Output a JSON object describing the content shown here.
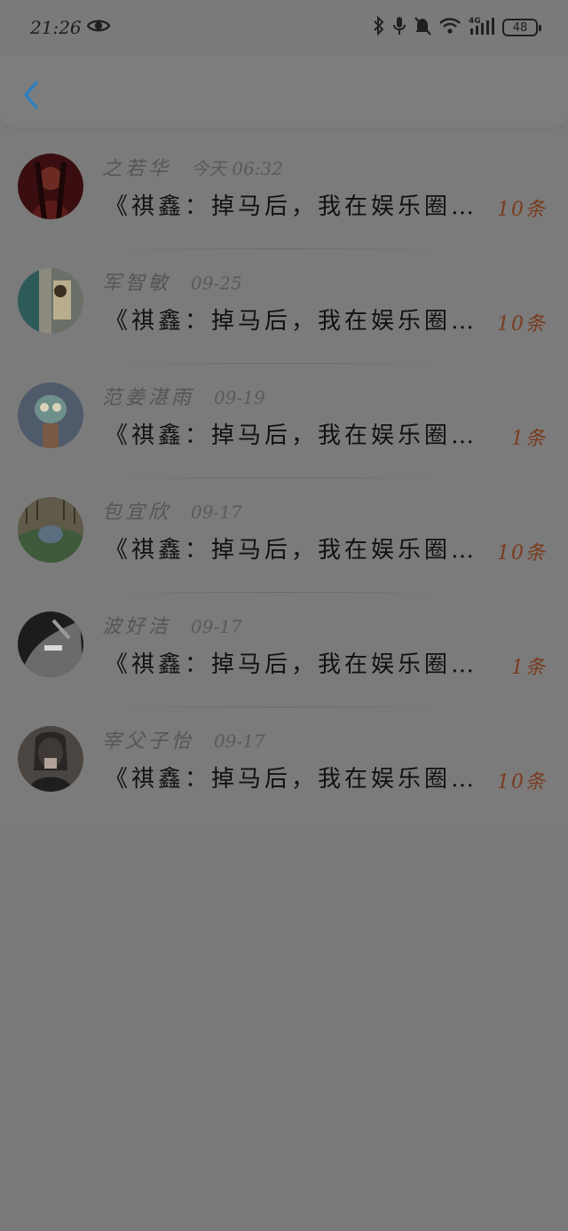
{
  "status_bar": {
    "time": "21:26",
    "battery": "48",
    "icons": [
      "eye-icon",
      "bluetooth-icon",
      "mic-icon",
      "bell-off-icon",
      "wifi-icon",
      "4g-signal-icon",
      "battery-icon"
    ]
  },
  "header": {
    "back_icon": "chevron-left-icon",
    "accent": "#2c7fbf"
  },
  "colors": {
    "count": "#7a3b1e",
    "name": "#555555",
    "message": "#111111"
  },
  "items": [
    {
      "name": "之若华",
      "time": "今天 06:32",
      "message": "《祺鑫：掉马后，我在娱乐圈…",
      "count": "10条",
      "avatar": "avatar-1"
    },
    {
      "name": "军智敏",
      "time": "09-25",
      "message": "《祺鑫：掉马后，我在娱乐圈…",
      "count": "10条",
      "avatar": "avatar-2"
    },
    {
      "name": "范姜湛雨",
      "time": "09-19",
      "message": "《祺鑫：掉马后，我在娱乐圈…",
      "count": "1条",
      "avatar": "avatar-3"
    },
    {
      "name": "包宜欣",
      "time": "09-17",
      "message": "《祺鑫：掉马后，我在娱乐圈…",
      "count": "10条",
      "avatar": "avatar-4"
    },
    {
      "name": "波好洁",
      "time": "09-17",
      "message": "《祺鑫：掉马后，我在娱乐圈…",
      "count": "1条",
      "avatar": "avatar-5"
    },
    {
      "name": "宰父子怡",
      "time": "09-17",
      "message": "《祺鑫：掉马后，我在娱乐圈…",
      "count": "10条",
      "avatar": "avatar-6"
    }
  ]
}
